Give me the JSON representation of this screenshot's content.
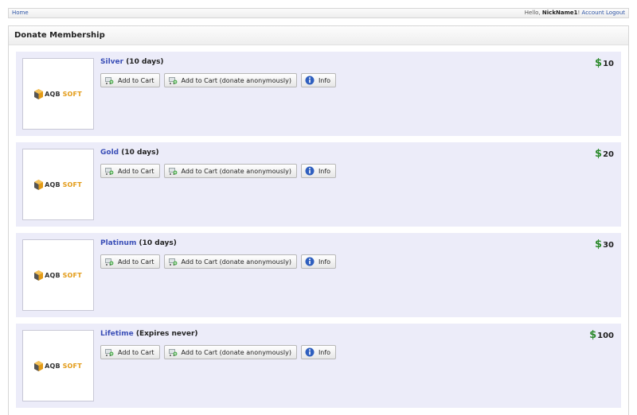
{
  "topbar": {
    "home_label": "Home",
    "greeting": "Hello, ",
    "username": "NickName1",
    "separator": "!",
    "account_label": "Account",
    "logout_label": "Logout"
  },
  "panel": {
    "title": "Donate Membership"
  },
  "logo": {
    "part1": "AQB",
    "part2": "SOFT"
  },
  "buttons": {
    "add_to_cart": "Add to Cart",
    "add_to_cart_anon": "Add to Cart (donate anonymously)",
    "info": "Info"
  },
  "products": [
    {
      "name": "Silver",
      "duration": " (10 days)",
      "currency": "$",
      "price": "10"
    },
    {
      "name": "Gold",
      "duration": " (10 days)",
      "currency": "$",
      "price": "20"
    },
    {
      "name": "Platinum",
      "duration": " (10 days)",
      "currency": "$",
      "price": "30"
    },
    {
      "name": "Lifetime",
      "duration": " (Expires never)",
      "currency": "$",
      "price": "100"
    }
  ],
  "colors": {
    "link": "#3b4fb7",
    "product_bg": "#ececf9",
    "price_symbol": "#2d8a2d",
    "logo_accent": "#e39b17"
  },
  "icons": {
    "cart": "cart-add-icon",
    "info": "info-icon",
    "logo": "aqb-cube-logo-icon"
  }
}
